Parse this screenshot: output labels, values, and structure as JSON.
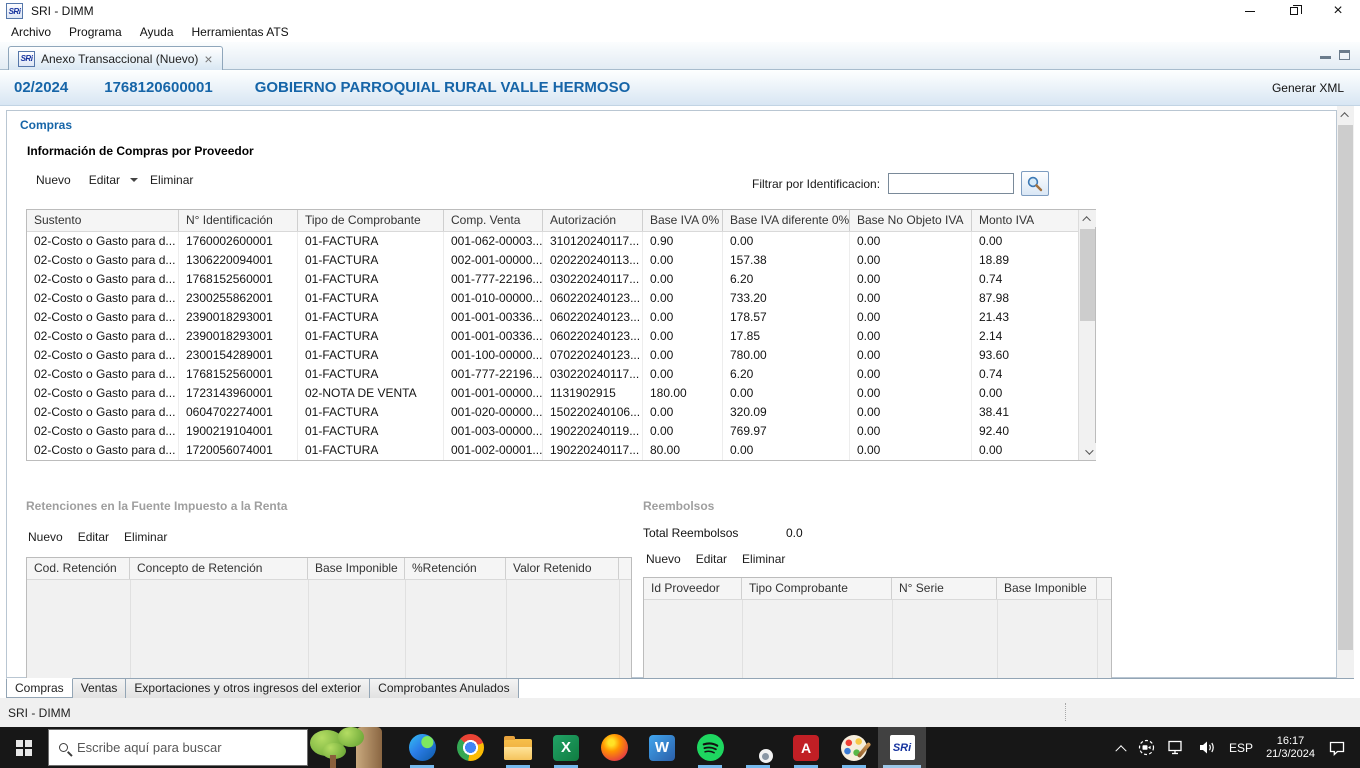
{
  "titlebar": {
    "title": "SRI - DIMM",
    "logo": "SRi"
  },
  "menubar": {
    "items": [
      "Archivo",
      "Programa",
      "Ayuda",
      "Herramientas ATS"
    ]
  },
  "view_tab": {
    "label": "Anexo Transaccional (Nuevo)",
    "logo": "SRi"
  },
  "header": {
    "period": "02/2024",
    "ruc": "1768120600001",
    "entity": "GOBIERNO PARROQUIAL RURAL VALLE HERMOSO",
    "action": "Generar XML"
  },
  "compras": {
    "group_label": "Compras",
    "section_title": "Información de Compras por Proveedor",
    "toolbar": {
      "nuevo": "Nuevo",
      "editar": "Editar",
      "eliminar": "Eliminar"
    },
    "filter": {
      "label": "Filtrar por Identificacion:",
      "value": ""
    },
    "table": {
      "columns": [
        "Sustento",
        "N° Identificación",
        "Tipo de Comprobante",
        "Comp. Venta",
        "Autorización",
        "Base IVA 0%",
        "Base IVA diferente 0%",
        "Base No Objeto IVA",
        "Monto IVA"
      ],
      "rows": [
        [
          "02-Costo o Gasto para d...",
          "1760002600001",
          "01-FACTURA",
          "001-062-00003...",
          "310120240117...",
          "0.90",
          "0.00",
          "0.00",
          "0.00"
        ],
        [
          "02-Costo o Gasto para d...",
          "1306220094001",
          "01-FACTURA",
          "002-001-00000...",
          "020220240113...",
          "0.00",
          "157.38",
          "0.00",
          "18.89"
        ],
        [
          "02-Costo o Gasto para d...",
          "1768152560001",
          "01-FACTURA",
          "001-777-22196...",
          "030220240117...",
          "0.00",
          "6.20",
          "0.00",
          "0.74"
        ],
        [
          "02-Costo o Gasto para d...",
          "2300255862001",
          "01-FACTURA",
          "001-010-00000...",
          "060220240123...",
          "0.00",
          "733.20",
          "0.00",
          "87.98"
        ],
        [
          "02-Costo o Gasto para d...",
          "2390018293001",
          "01-FACTURA",
          "001-001-00336...",
          "060220240123...",
          "0.00",
          "178.57",
          "0.00",
          "21.43"
        ],
        [
          "02-Costo o Gasto para d...",
          "2390018293001",
          "01-FACTURA",
          "001-001-00336...",
          "060220240123...",
          "0.00",
          "17.85",
          "0.00",
          "2.14"
        ],
        [
          "02-Costo o Gasto para d...",
          "2300154289001",
          "01-FACTURA",
          "001-100-00000...",
          "070220240123...",
          "0.00",
          "780.00",
          "0.00",
          "93.60"
        ],
        [
          "02-Costo o Gasto para d...",
          "1768152560001",
          "01-FACTURA",
          "001-777-22196...",
          "030220240117...",
          "0.00",
          "6.20",
          "0.00",
          "0.74"
        ],
        [
          "02-Costo o Gasto para d...",
          "1723143960001",
          "02-NOTA DE VENTA",
          "001-001-00000...",
          "1131902915",
          "180.00",
          "0.00",
          "0.00",
          "0.00"
        ],
        [
          "02-Costo o Gasto para d...",
          "0604702274001",
          "01-FACTURA",
          "001-020-00000...",
          "150220240106...",
          "0.00",
          "320.09",
          "0.00",
          "38.41"
        ],
        [
          "02-Costo o Gasto para d...",
          "1900219104001",
          "01-FACTURA",
          "001-003-00000...",
          "190220240119...",
          "0.00",
          "769.97",
          "0.00",
          "92.40"
        ],
        [
          "02-Costo o Gasto para d...",
          "1720056074001",
          "01-FACTURA",
          "001-002-00001...",
          "190220240117...",
          "80.00",
          "0.00",
          "0.00",
          "0.00"
        ]
      ]
    }
  },
  "retenciones": {
    "title": "Retenciones en la Fuente  Impuesto a la Renta",
    "toolbar": {
      "nuevo": "Nuevo",
      "editar": "Editar",
      "eliminar": "Eliminar"
    },
    "table": {
      "columns": [
        "Cod. Retención",
        "Concepto de Retención",
        "Base Imponible",
        "%Retención",
        "Valor Retenido"
      ]
    }
  },
  "reembolsos": {
    "title": "Reembolsos",
    "total_label": "Total Reembolsos",
    "total_value": "0.0",
    "toolbar": {
      "nuevo": "Nuevo",
      "editar": "Editar",
      "eliminar": "Eliminar"
    },
    "table": {
      "columns": [
        "Id Proveedor",
        "Tipo Comprobante",
        "N° Serie",
        "Base Imponible"
      ]
    }
  },
  "bottom_tabs": {
    "tabs": [
      "Compras",
      "Ventas",
      "Exportaciones y otros ingresos del exterior",
      "Comprobantes Anulados"
    ],
    "active": "Compras"
  },
  "statusbar": {
    "text": "SRI - DIMM"
  },
  "taskbar": {
    "search_placeholder": "Escribe aquí para buscar",
    "language": "ESP",
    "time": "16:17",
    "date": "21/3/2024",
    "apps": [
      "windows-start",
      "search-box",
      "search-highlight-trees",
      "edge",
      "chrome",
      "file-explorer",
      "excel",
      "firefox",
      "word",
      "spotify",
      "chrome-app",
      "acrobat",
      "paint",
      "sri-dimm"
    ]
  },
  "colors": {
    "accent": "#1665a8",
    "gray_title": "#9f9f9f",
    "taskbar_bg": "#171717",
    "running_indicator": "#76b9ed"
  }
}
